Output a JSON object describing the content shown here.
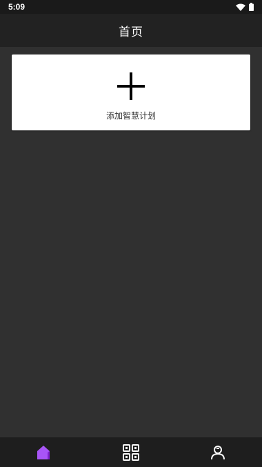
{
  "status_bar": {
    "time": "5:09",
    "icons": [
      "wifi-icon",
      "battery-icon"
    ]
  },
  "app_bar": {
    "title": "首页"
  },
  "add_card": {
    "icon": "plus-icon",
    "label": "添加智慧计划"
  },
  "bottom_nav": {
    "items": [
      {
        "icon": "home-icon",
        "active": true
      },
      {
        "icon": "scan-grid-icon",
        "active": false
      },
      {
        "icon": "person-icon",
        "active": false
      }
    ]
  },
  "colors": {
    "background": "#303030",
    "app_bar": "#222222",
    "status_bar": "#1a1a1a",
    "bottom_nav": "#1e1e1e",
    "card": "#ffffff",
    "accent": "#a855f7",
    "inactive_icon": "#ffffff"
  }
}
